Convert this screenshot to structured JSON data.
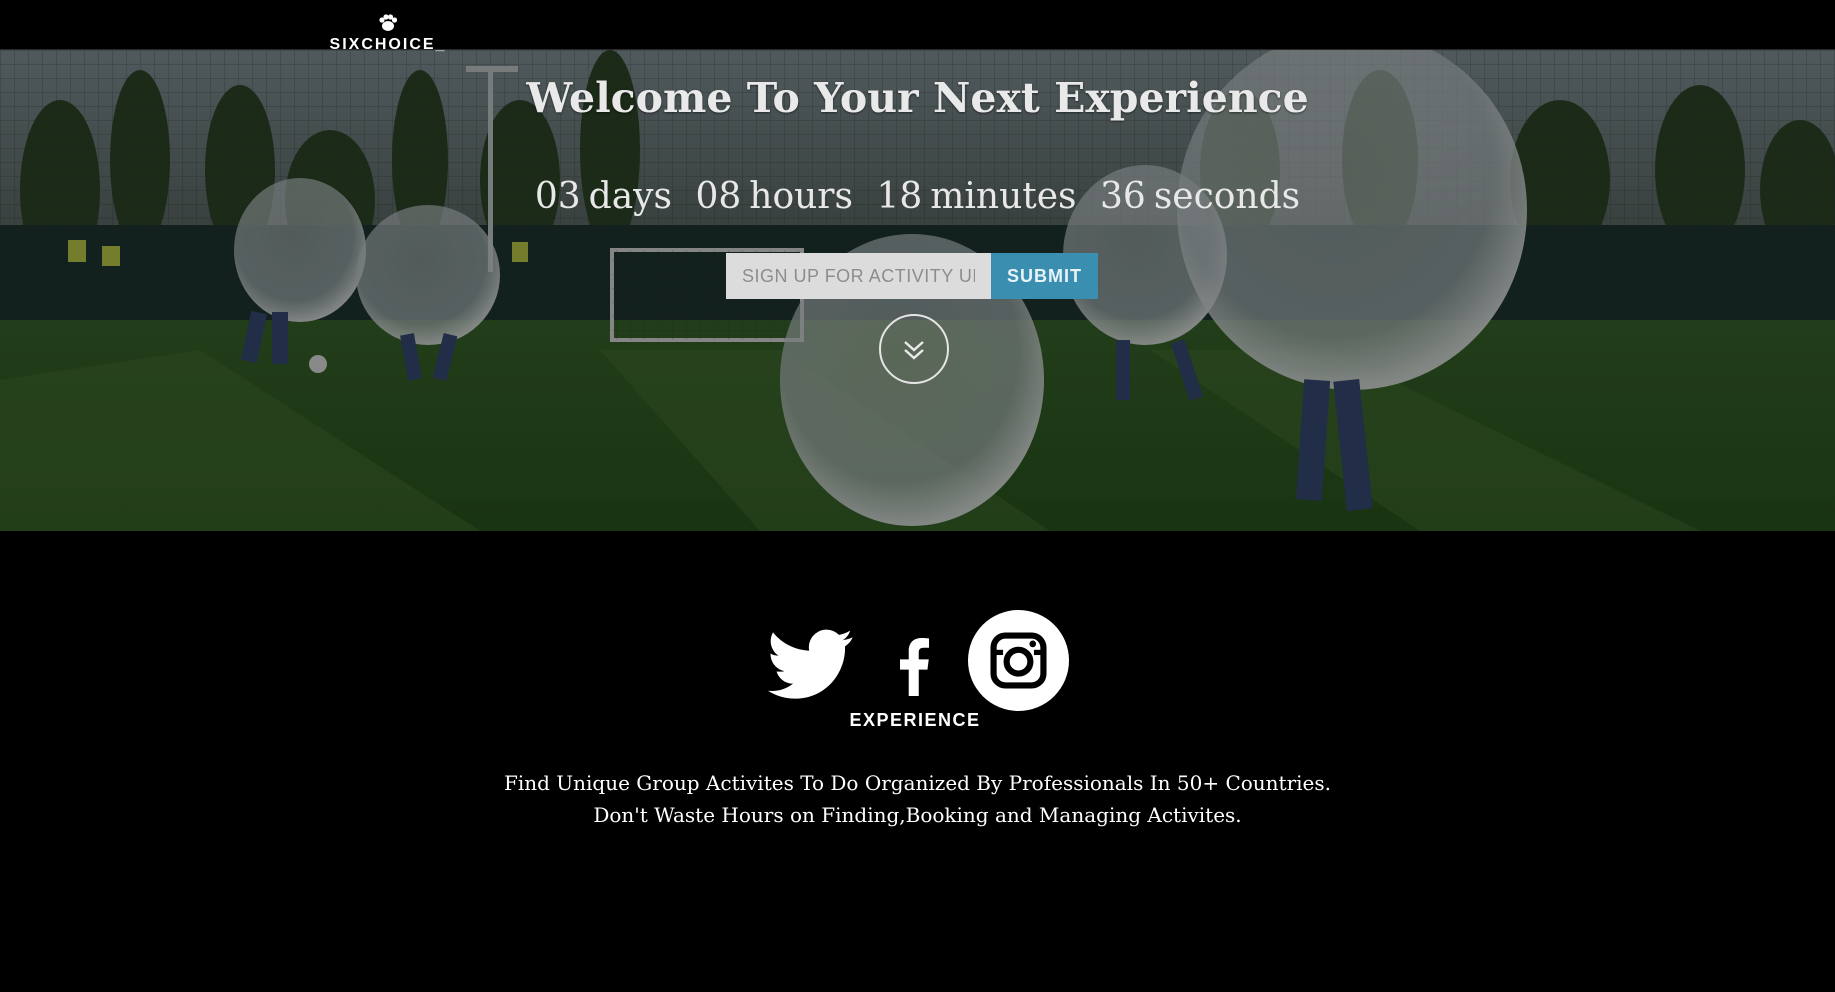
{
  "brand": {
    "logo_text": "SIXCHOICE_",
    "logo_icon": "paw-icon"
  },
  "hero": {
    "title": "Welcome To Your Next Experience",
    "countdown": {
      "days_value": "03",
      "days_label": "days",
      "hours_value": "08",
      "hours_label": "hours",
      "minutes_value": "18",
      "minutes_label": "minutes",
      "seconds_value": "36",
      "seconds_label": "seconds"
    },
    "signup": {
      "placeholder": "SIGN UP FOR ACTIVITY UPDATES",
      "submit_label": "SUBMIT"
    },
    "scroll_icon": "double-chevron-down-icon"
  },
  "social": {
    "icons": [
      "twitter-icon",
      "facebook-icon",
      "instagram-icon"
    ],
    "caption": "EXPERIENCE"
  },
  "tagline": {
    "line1": "Find Unique Group Activites To Do Organized By Professionals In 50+ Countries.",
    "line2": "Don't Waste Hours on Finding,Booking and Managing Activites."
  },
  "colors": {
    "background": "#000000",
    "submit_button": "#3a8fb1",
    "input_background": "#dcdcdc"
  }
}
